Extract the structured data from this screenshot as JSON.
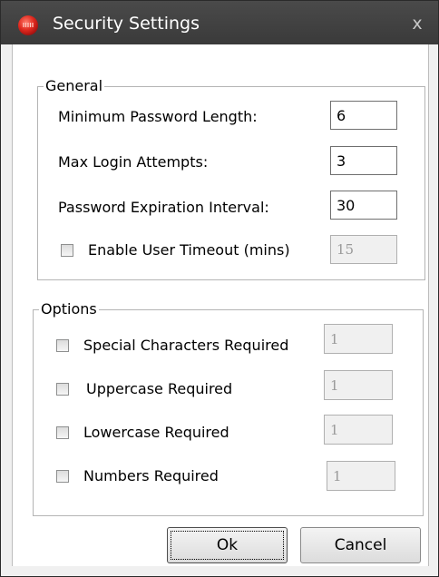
{
  "window": {
    "title": "Security Settings",
    "close_glyph": "x",
    "app_icon": "red-power-icon"
  },
  "general": {
    "legend": "General",
    "min_password_length": {
      "label": "Minimum Password Length:",
      "value": "6"
    },
    "max_login_attempts": {
      "label": "Max Login Attempts:",
      "value": "3"
    },
    "password_expiration": {
      "label": "Password Expiration Interval:",
      "value": "30"
    },
    "user_timeout": {
      "label": "Enable User Timeout (mins)",
      "value": "15",
      "checked": false,
      "enabled": false
    }
  },
  "options": {
    "legend": "Options",
    "special_chars": {
      "label": "Special Characters Required",
      "value": "1",
      "checked": false
    },
    "uppercase": {
      "label": "Uppercase Required",
      "value": "1",
      "checked": false
    },
    "lowercase": {
      "label": "Lowercase Required",
      "value": "1",
      "checked": false
    },
    "numbers": {
      "label": "Numbers Required",
      "value": "1",
      "checked": false
    }
  },
  "buttons": {
    "ok": "Ok",
    "cancel": "Cancel"
  },
  "colors": {
    "titlebar": "#3d3d3d",
    "icon_red": "#d42020"
  }
}
